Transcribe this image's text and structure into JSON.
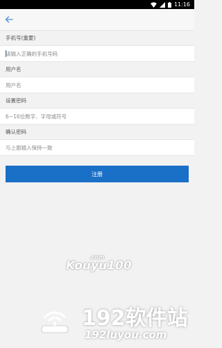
{
  "status_bar": {
    "time": "11:16"
  },
  "form": {
    "phone": {
      "label": "手机号(重要)",
      "placeholder": "请输入正确的手机号码"
    },
    "username": {
      "label": "用户名",
      "placeholder": "用户名"
    },
    "password": {
      "label": "设置密码",
      "placeholder": "6~16位数字、字母或符号"
    },
    "confirm": {
      "label": "确认密码",
      "placeholder": "与上面输入保持一致"
    }
  },
  "register_button": {
    "label": "注册"
  },
  "watermarks": {
    "kouyu_main": "Kouyu100",
    "kouyu_sub": ".com",
    "site_name": "192软件站",
    "site_url": "192luyou.com"
  },
  "colors": {
    "accent": "#1a6fc7",
    "background": "#f2f2f2"
  }
}
